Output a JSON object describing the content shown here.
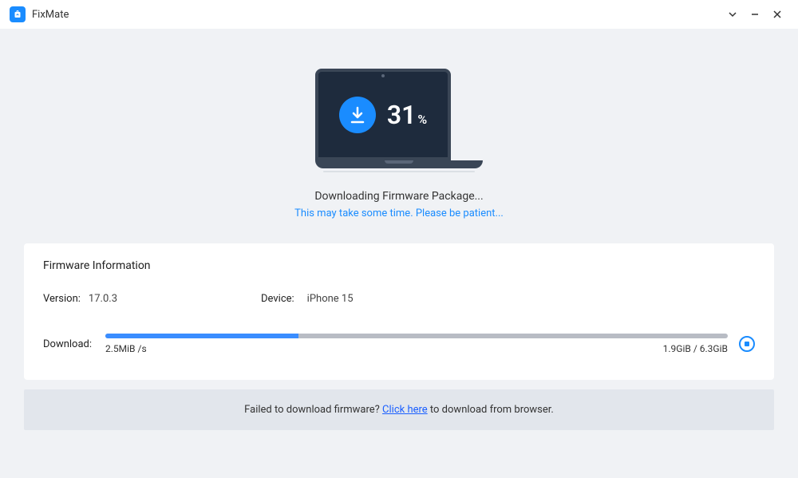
{
  "app": {
    "title": "FixMate"
  },
  "progress": {
    "percent": 31,
    "symbol": "%"
  },
  "status": {
    "main": "Downloading Firmware Package...",
    "sub": "This may take some time. Please be patient..."
  },
  "panel": {
    "title": "Firmware Information",
    "version_label": "Version:",
    "version_value": "17.0.3",
    "device_label": "Device:",
    "device_value": "iPhone 15",
    "download_label": "Download:",
    "progress_percent": 31,
    "speed": "2.5MiB /s",
    "size": "1.9GiB / 6.3GiB"
  },
  "footer": {
    "prefix": "Failed to download firmware? ",
    "link": "Click here",
    "suffix": " to download from browser."
  }
}
